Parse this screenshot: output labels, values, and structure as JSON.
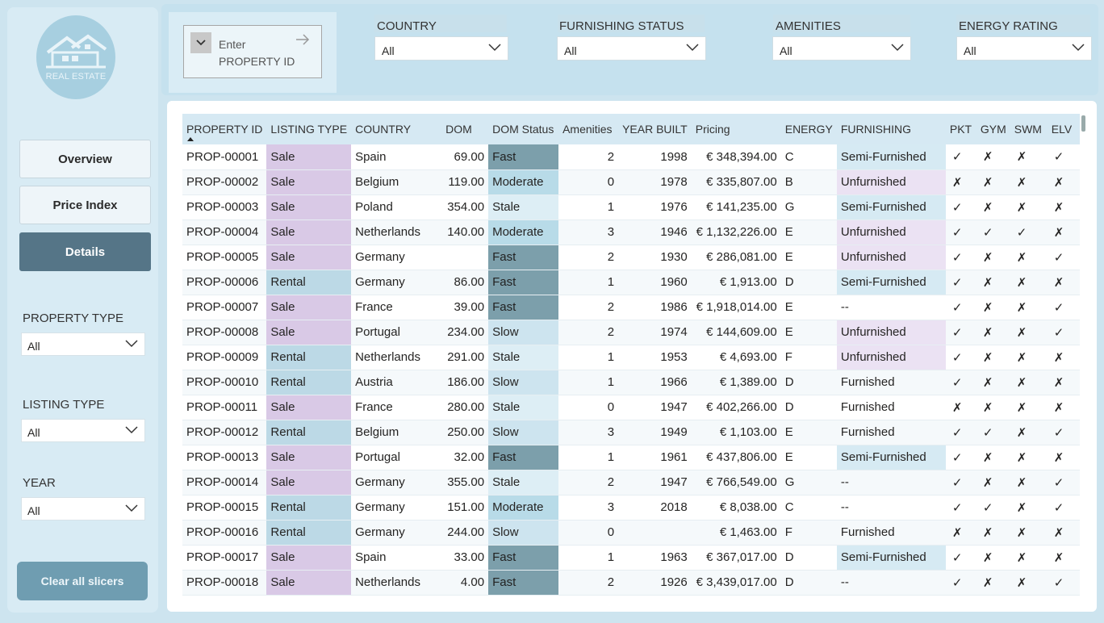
{
  "sidebar": {
    "logo_text": "REAL ESTATE",
    "nav": [
      {
        "label": "Overview",
        "active": false
      },
      {
        "label": "Price Index",
        "active": false
      },
      {
        "label": "Details",
        "active": true
      }
    ],
    "filters": [
      {
        "label": "PROPERTY TYPE",
        "value": "All"
      },
      {
        "label": "LISTING TYPE",
        "value": "All"
      },
      {
        "label": "YEAR",
        "value": "All"
      }
    ],
    "clear_label": "Clear all slicers"
  },
  "search": {
    "line1": "Enter",
    "line2": "PROPERTY ID"
  },
  "top_filters": [
    {
      "label": "COUNTRY",
      "value": "All"
    },
    {
      "label": "FURNISHING STATUS",
      "value": "All"
    },
    {
      "label": "AMENITIES",
      "value": "All"
    },
    {
      "label": "ENERGY RATING",
      "value": "All"
    }
  ],
  "table": {
    "columns": [
      "PROPERTY ID",
      "LISTING TYPE",
      "COUNTRY",
      "DOM",
      "DOM Status",
      "Amenities",
      "YEAR BUILT",
      "Pricing",
      "ENERGY",
      "FURNISHING",
      "PKT",
      "GYM",
      "SWM",
      "ELV"
    ],
    "rows": [
      [
        "PROP-00001",
        "Sale",
        "Spain",
        "69.00",
        "Fast",
        "2",
        "1998",
        "€ 348,394.00",
        "C",
        "Semi-Furnished",
        "✓",
        "✗",
        "✗",
        "✓"
      ],
      [
        "PROP-00002",
        "Sale",
        "Belgium",
        "119.00",
        "Moderate",
        "0",
        "1978",
        "€ 335,807.00",
        "B",
        "Unfurnished",
        "✗",
        "✗",
        "✗",
        "✗"
      ],
      [
        "PROP-00003",
        "Sale",
        "Poland",
        "354.00",
        "Stale",
        "1",
        "1976",
        "€ 141,235.00",
        "G",
        "Semi-Furnished",
        "✓",
        "✗",
        "✗",
        "✗"
      ],
      [
        "PROP-00004",
        "Sale",
        "Netherlands",
        "140.00",
        "Moderate",
        "3",
        "1946",
        "€ 1,132,226.00",
        "E",
        "Unfurnished",
        "✓",
        "✓",
        "✓",
        "✗"
      ],
      [
        "PROP-00005",
        "Sale",
        "Germany",
        "",
        "Fast",
        "2",
        "1930",
        "€ 286,081.00",
        "E",
        "Unfurnished",
        "✓",
        "✗",
        "✗",
        "✓"
      ],
      [
        "PROP-00006",
        "Rental",
        "Germany",
        "86.00",
        "Fast",
        "1",
        "1960",
        "€ 1,913.00",
        "D",
        "Semi-Furnished",
        "✓",
        "✗",
        "✗",
        "✗"
      ],
      [
        "PROP-00007",
        "Sale",
        "France",
        "39.00",
        "Fast",
        "2",
        "1986",
        "€ 1,918,014.00",
        "E",
        "--",
        "✓",
        "✗",
        "✗",
        "✓"
      ],
      [
        "PROP-00008",
        "Sale",
        "Portugal",
        "234.00",
        "Slow",
        "2",
        "1974",
        "€ 144,609.00",
        "E",
        "Unfurnished",
        "✓",
        "✗",
        "✗",
        "✓"
      ],
      [
        "PROP-00009",
        "Rental",
        "Netherlands",
        "291.00",
        "Stale",
        "1",
        "1953",
        "€ 4,693.00",
        "F",
        "Unfurnished",
        "✓",
        "✗",
        "✗",
        "✗"
      ],
      [
        "PROP-00010",
        "Rental",
        "Austria",
        "186.00",
        "Slow",
        "1",
        "1966",
        "€ 1,389.00",
        "D",
        "Furnished",
        "✓",
        "✗",
        "✗",
        "✗"
      ],
      [
        "PROP-00011",
        "Sale",
        "France",
        "280.00",
        "Stale",
        "0",
        "1947",
        "€ 402,266.00",
        "D",
        "Furnished",
        "✗",
        "✗",
        "✗",
        "✗"
      ],
      [
        "PROP-00012",
        "Rental",
        "Belgium",
        "250.00",
        "Slow",
        "3",
        "1949",
        "€ 1,103.00",
        "E",
        "Furnished",
        "✓",
        "✓",
        "✗",
        "✓"
      ],
      [
        "PROP-00013",
        "Sale",
        "Portugal",
        "32.00",
        "Fast",
        "1",
        "1961",
        "€ 437,806.00",
        "E",
        "Semi-Furnished",
        "✓",
        "✗",
        "✗",
        "✗"
      ],
      [
        "PROP-00014",
        "Sale",
        "Germany",
        "355.00",
        "Stale",
        "2",
        "1947",
        "€ 766,549.00",
        "G",
        "--",
        "✓",
        "✗",
        "✗",
        "✓"
      ],
      [
        "PROP-00015",
        "Rental",
        "Germany",
        "151.00",
        "Moderate",
        "3",
        "2018",
        "€ 8,038.00",
        "C",
        "--",
        "✓",
        "✓",
        "✗",
        "✓"
      ],
      [
        "PROP-00016",
        "Rental",
        "Germany",
        "244.00",
        "Slow",
        "0",
        "",
        "€ 1,463.00",
        "F",
        "Furnished",
        "✗",
        "✗",
        "✗",
        "✗"
      ],
      [
        "PROP-00017",
        "Sale",
        "Spain",
        "33.00",
        "Fast",
        "1",
        "1963",
        "€ 367,017.00",
        "D",
        "Semi-Furnished",
        "✓",
        "✗",
        "✗",
        "✗"
      ],
      [
        "PROP-00018",
        "Sale",
        "Netherlands",
        "4.00",
        "Fast",
        "2",
        "1926",
        "€ 3,439,017.00",
        "D",
        "--",
        "✓",
        "✗",
        "✗",
        "✓"
      ]
    ]
  }
}
